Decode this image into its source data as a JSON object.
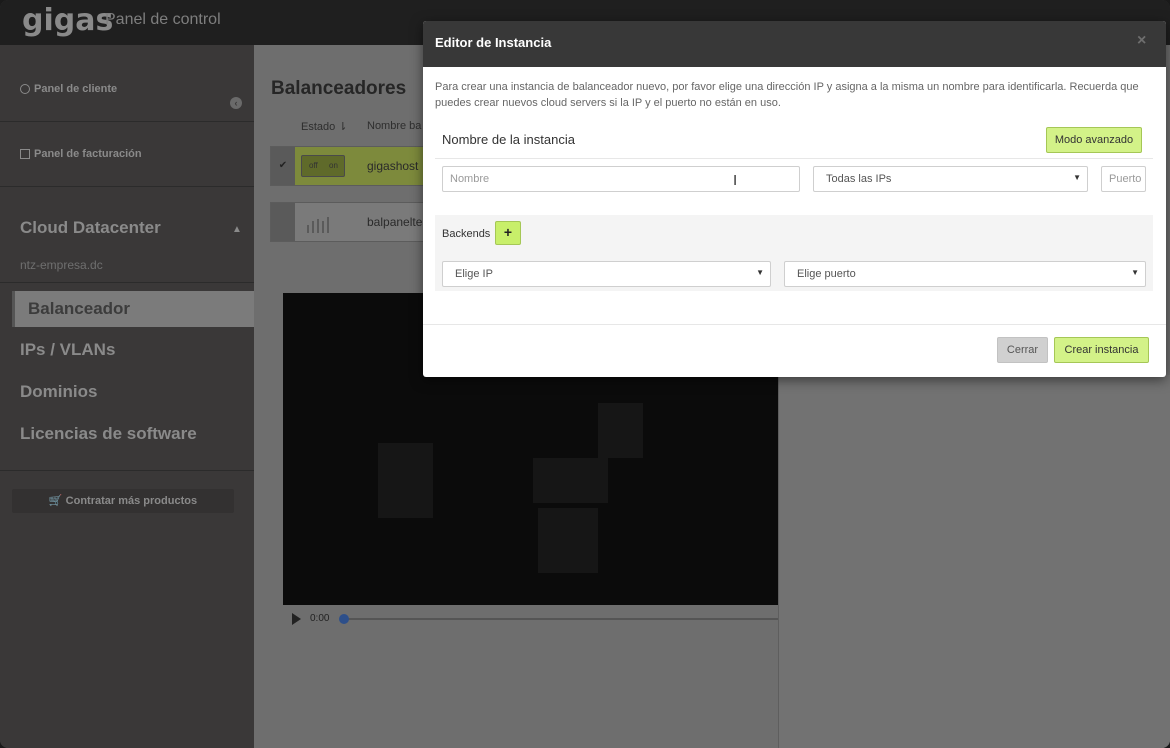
{
  "topbar": {
    "logo": "gigas",
    "subtitle": "Panel de control"
  },
  "sidebar": {
    "client_panel": "Panel de cliente",
    "billing_panel": "Panel de facturación",
    "section_title": "Cloud Datacenter",
    "datacenter_name": "ntz-empresa.dc",
    "items": [
      {
        "label": "Balanceador",
        "active": true
      },
      {
        "label": "IPs / VLANs",
        "active": false
      },
      {
        "label": "Dominios",
        "active": false
      },
      {
        "label": "Licencias de software",
        "active": false
      }
    ],
    "buy_button": "Contratar más productos"
  },
  "main": {
    "title": "Balanceadores",
    "columns": {
      "status": "Estado ⇂",
      "name": "Nombre ba"
    },
    "rows": [
      {
        "toggle_off": "off",
        "toggle_on": "on",
        "name": "gigashost"
      },
      {
        "name": "balpanelte"
      }
    ],
    "player": {
      "time": "0:00"
    }
  },
  "modal": {
    "title": "Editor de Instancia",
    "close": "×",
    "description": "Para crear una instancia de balanceador nuevo, por favor elige una dirección IP y asigna a la misma un nombre para identificarla. Recuerda que puedes crear nuevos cloud servers si la IP y el puerto no están en uso.",
    "instance_label": "Nombre de la instancia",
    "advanced_button": "Modo avanzado",
    "name_placeholder": "Nombre",
    "ip_select": "Todas las IPs",
    "port_placeholder": "Puerto",
    "backends_label": "Backends",
    "add_backend": "+",
    "backend_ip_select": "Elige IP",
    "backend_port_select": "Elige puerto",
    "close_button": "Cerrar",
    "create_button": "Crear instancia"
  },
  "colors": {
    "accent": "#d3f288",
    "modal_header": "#383838",
    "sidebar": "#3a3838"
  }
}
